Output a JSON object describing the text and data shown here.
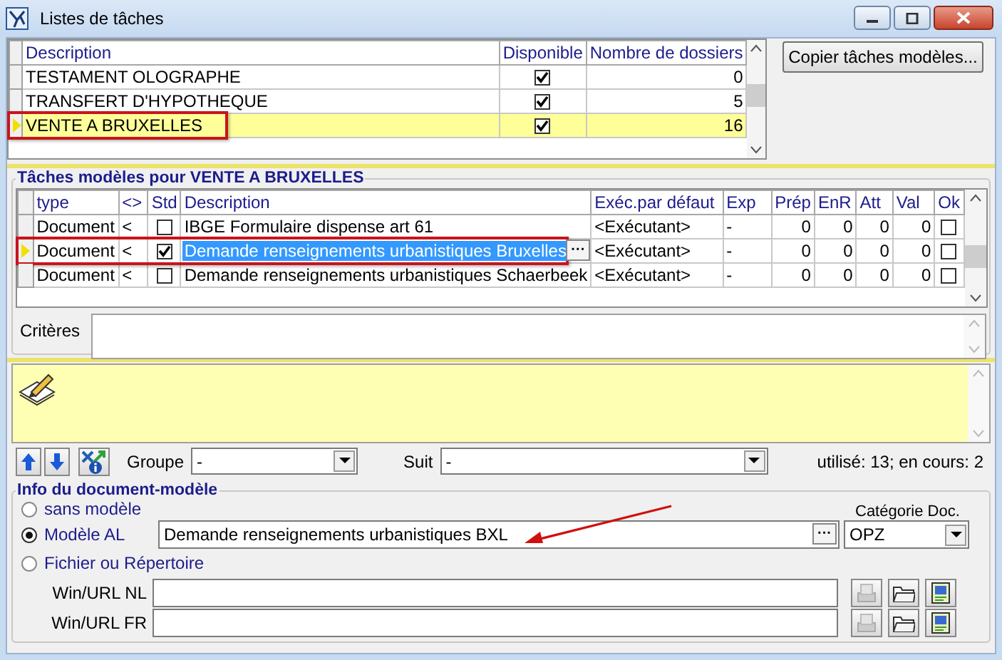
{
  "window": {
    "title": "Listes de tâches"
  },
  "task_lists": {
    "columns": [
      "Description",
      "Disponible",
      "Nombre de dossiers"
    ],
    "rows": [
      {
        "description": "TESTAMENT OLOGRAPHE",
        "available": true,
        "count": "0",
        "selected": false,
        "outlined": false
      },
      {
        "description": "TRANSFERT D'HYPOTHEQUE",
        "available": true,
        "count": "5",
        "selected": false,
        "outlined": false
      },
      {
        "description": "VENTE A BRUXELLES",
        "available": true,
        "count": "16",
        "selected": true,
        "outlined": true
      }
    ]
  },
  "copy_button": "Copier tâches modèles...",
  "models": {
    "title": "Tâches modèles pour VENTE A BRUXELLES",
    "columns": [
      "type",
      "<>",
      "Std",
      "Description",
      "Exéc.par défaut",
      "Exp",
      "Prép",
      "EnR",
      "Att",
      "Val",
      "Ok"
    ],
    "rows": [
      {
        "type": "Document",
        "direction": "<",
        "std": false,
        "description": "IBGE Formulaire dispense art 61",
        "executor": "<Exécutant>",
        "exp": "-",
        "prep": "0",
        "enr": "0",
        "att": "0",
        "val": "0",
        "ok": false,
        "selected": false,
        "outlined": false
      },
      {
        "type": "Document",
        "direction": "<",
        "std": true,
        "description": "Demande renseignements urbanistiques Bruxelles",
        "executor": "<Exécutant>",
        "exp": "-",
        "prep": "0",
        "enr": "0",
        "att": "0",
        "val": "0",
        "ok": false,
        "selected": true,
        "outlined": true
      },
      {
        "type": "Document",
        "direction": "<",
        "std": false,
        "description": "Demande renseignements urbanistiques Schaerbeek",
        "executor": "<Exécutant>",
        "exp": "-",
        "prep": "0",
        "enr": "0",
        "att": "0",
        "val": "0",
        "ok": false,
        "selected": false,
        "outlined": false
      }
    ],
    "ellipsis": "···"
  },
  "criteria": {
    "label": "Critères"
  },
  "toolbar": {
    "group_label": "Groupe",
    "group_value": "-",
    "follows_label": "Suit",
    "follows_value": "-",
    "usage": "utilisé: 13; en cours: 2"
  },
  "doc_info": {
    "title": "Info du document-modèle",
    "options": [
      {
        "label": "sans modèle",
        "selected": false
      },
      {
        "label": "Modèle AL",
        "selected": true
      },
      {
        "label": "Fichier ou Répertoire",
        "selected": false
      }
    ],
    "model_value": "Demande renseignements urbanistiques BXL",
    "model_button": "···",
    "category_label": "Catégorie Doc.",
    "category_value": "OPZ",
    "paths": [
      {
        "label": "Win/URL NL"
      },
      {
        "label": "Win/URL FR"
      }
    ]
  }
}
